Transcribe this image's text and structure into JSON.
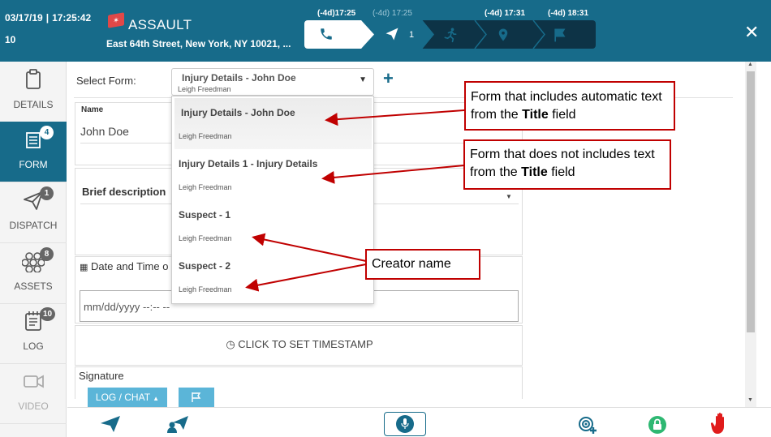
{
  "header": {
    "date": "03/17/19",
    "time": "17:25:42",
    "number": "10",
    "title": "ASSAULT",
    "address": "East 64th Street, New York, NY 10021, ...",
    "timestamps": [
      "(-4d)17:25",
      "(-4d) 17:25",
      "(-4d) 17:31",
      "(-4d) 18:31"
    ],
    "step_count": "1"
  },
  "sidebar": {
    "items": [
      {
        "label": "DETAILS",
        "icon": "clipboard-icon",
        "badge": ""
      },
      {
        "label": "FORM",
        "icon": "form-icon",
        "badge": "4"
      },
      {
        "label": "DISPATCH",
        "icon": "paper-plane-icon",
        "badge": "1"
      },
      {
        "label": "ASSETS",
        "icon": "hexagons-icon",
        "badge": "8"
      },
      {
        "label": "LOG",
        "icon": "log-icon",
        "badge": "10"
      },
      {
        "label": "VIDEO",
        "icon": "video-camera-icon",
        "badge": ""
      }
    ]
  },
  "select_form": {
    "label": "Select Form:",
    "selected_title": "Injury Details - John Doe",
    "selected_creator": "Leigh Freedman"
  },
  "dropdown": {
    "options": [
      {
        "title": "Injury Details - John Doe",
        "creator": "Leigh Freedman"
      },
      {
        "title": "Injury Details 1 - Injury Details",
        "creator": "Leigh Freedman"
      },
      {
        "title": "Suspect - 1",
        "creator": "Leigh Freedman"
      },
      {
        "title": "Suspect - 2",
        "creator": "Leigh Freedman"
      }
    ]
  },
  "form": {
    "name_label": "Name",
    "name_value": "John Doe",
    "brief_label": "Brief description",
    "date_label": "Date and Time o",
    "date_placeholder": "mm/dd/yyyy  --:--  --",
    "timestamp_button": "CLICK TO SET TIMESTAMP",
    "signature_label": "Signature"
  },
  "annotations": {
    "a1_pre": "Form that includes automatic text from the ",
    "a1_bold": "Title",
    "a1_post": " field",
    "a2_pre": "Form that does not includes text from the ",
    "a2_bold": "Title",
    "a2_post": " field",
    "a3": "Creator name"
  },
  "bottom": {
    "log_chat": "LOG / CHAT"
  },
  "colors": {
    "primary": "#176b8a",
    "dark": "#0d3346",
    "annotation": "#c00000",
    "button": "#5bb5d8",
    "alert_red": "#e01b1b",
    "green": "#2eb872"
  }
}
